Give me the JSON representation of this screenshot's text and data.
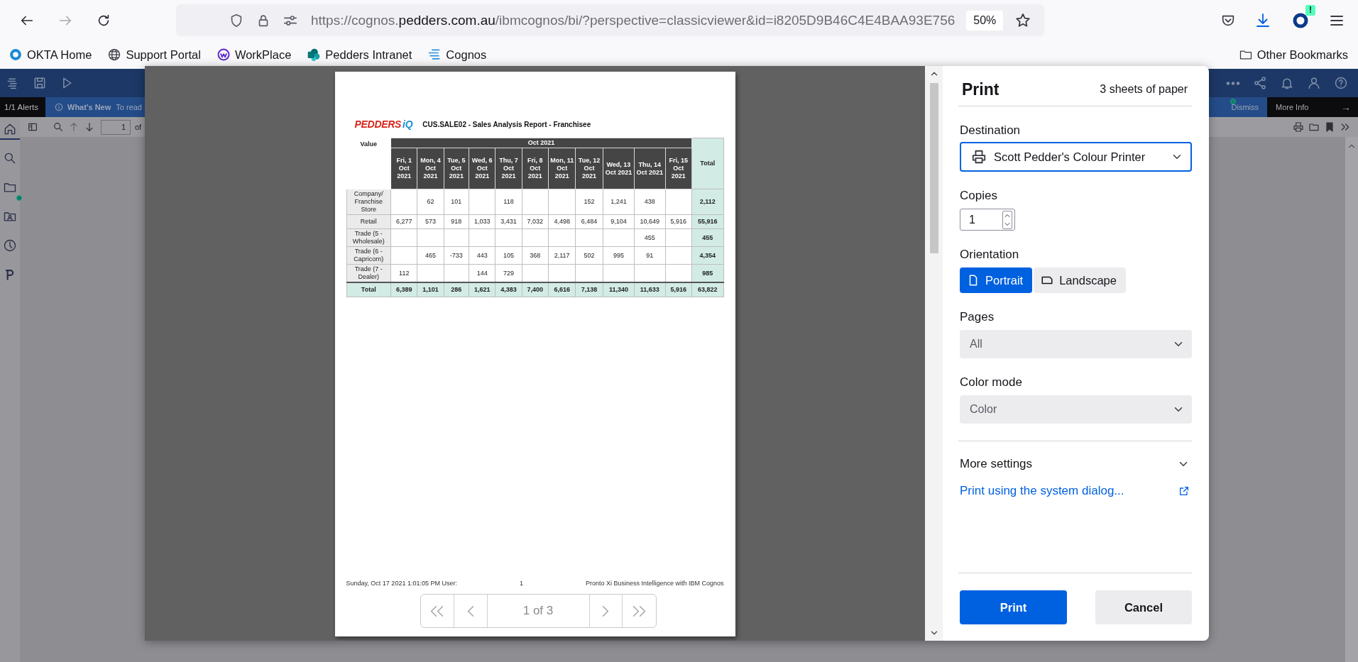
{
  "browser": {
    "nav_buttons": [
      {
        "kind": "back",
        "disabled": false
      },
      {
        "kind": "forward",
        "disabled": true
      },
      {
        "kind": "reload",
        "disabled": false
      }
    ],
    "url": {
      "prefix": "https://cognos.",
      "domain": "pedders.com.au",
      "rest": "/ibmcognos/bi/?perspective=classicviewer&id=i8205D9B46C4E4BAA93E756"
    },
    "zoom": "50%",
    "extension_badge": "!"
  },
  "bookmarks": [
    {
      "label": "OKTA Home",
      "kind": "okta"
    },
    {
      "label": "Support Portal",
      "kind": "globe"
    },
    {
      "label": "WorkPlace",
      "kind": "workplace"
    },
    {
      "label": "Pedders Intranet",
      "kind": "sharepoint"
    },
    {
      "label": "Cognos",
      "kind": "cognos"
    }
  ],
  "other_bookmarks": "Other Bookmarks",
  "app": {
    "nav": [
      {
        "kind": "home",
        "selected": true
      },
      {
        "kind": "search",
        "selected": false
      },
      {
        "kind": "folder",
        "selected": false
      },
      {
        "kind": "team-folder",
        "selected": false
      },
      {
        "kind": "recent",
        "selected": false
      },
      {
        "kind": "p-logo",
        "selected": false
      }
    ],
    "alerts": "1/1 Alerts",
    "whats_new": "What's New",
    "alert_text": "To read",
    "dismiss": "Dismiss",
    "more_info": "More Info",
    "more_info_arrow": "→",
    "page_field": "1",
    "page_of": "of"
  },
  "print_dialog": {
    "title": "Print",
    "sheets": "3 sheets of paper",
    "destination": {
      "label": "Destination",
      "value": "Scott Pedder's Colour Printer",
      "focused": true
    },
    "copies": {
      "label": "Copies",
      "value": "1"
    },
    "orientation": {
      "label": "Orientation",
      "options": [
        {
          "label": "Portrait",
          "kind": "portrait",
          "selected": true
        },
        {
          "label": "Landscape",
          "kind": "landscape",
          "selected": false
        }
      ]
    },
    "pages": {
      "label": "Pages",
      "value": "All"
    },
    "color_mode": {
      "label": "Color mode",
      "value": "Color"
    },
    "more_settings": {
      "label": "More settings",
      "expanded": false
    },
    "system_dialog_link": "Print using the system dialog...",
    "buttons": [
      {
        "label": "Print",
        "kind": "primary"
      },
      {
        "label": "Cancel",
        "kind": "secondary"
      }
    ],
    "preview": {
      "logo": {
        "brand": "PEDDERS",
        "suffix": "iQ"
      },
      "title": "CUS.SALE02 - Sales Analysis Report - Franchisee",
      "corner": "Value",
      "period": "Oct 2021",
      "columns": [
        "Fri, 1 Oct 2021",
        "Mon, 4 Oct 2021",
        "Tue, 5 Oct 2021",
        "Wed, 6 Oct 2021",
        "Thu, 7 Oct 2021",
        "Fri, 8 Oct 2021",
        "Mon, 11 Oct 2021",
        "Tue, 12 Oct 2021",
        "Wed, 13 Oct 2021",
        "Thu, 14 Oct 2021",
        "Fri, 15 Oct 2021"
      ],
      "total_header": "Total",
      "rows": [
        {
          "label": "Company/ Franchise Store",
          "cells": [
            null,
            "62",
            "101",
            null,
            "118",
            null,
            null,
            "152",
            "1,241",
            "438",
            null
          ],
          "total": "2,112"
        },
        {
          "label": "Retail",
          "cells": [
            "6,277",
            "573",
            "918",
            "1,033",
            "3,431",
            "7,032",
            "4,498",
            "6,484",
            "9,104",
            "10,649",
            "5,916"
          ],
          "total": "55,916"
        },
        {
          "label": "Trade (5 - Wholesale)",
          "cells": [
            null,
            null,
            null,
            null,
            null,
            null,
            null,
            null,
            null,
            "455",
            null
          ],
          "total": "455"
        },
        {
          "label": "Trade (6 - Capricorn)",
          "cells": [
            null,
            "465",
            "-733",
            "443",
            "105",
            "368",
            "2,117",
            "502",
            "995",
            "91",
            null
          ],
          "total": "4,354"
        },
        {
          "label": "Trade (7 - Dealer)",
          "cells": [
            "112",
            null,
            null,
            "144",
            "729",
            null,
            null,
            null,
            null,
            null,
            null
          ],
          "total": "985"
        }
      ],
      "total_row": {
        "label": "Total",
        "cells": [
          "6,389",
          "1,101",
          "286",
          "1,621",
          "4,383",
          "7,400",
          "6,616",
          "7,138",
          "11,340",
          "11,633",
          "5,916"
        ],
        "total": "63,822"
      },
      "footer": {
        "left": "Sunday, Oct 17 2021 1:01:05 PM User:",
        "center": "1",
        "right": "Pronto Xi Business Intelligence with IBM Cognos"
      },
      "pager": "1 of 3"
    }
  }
}
